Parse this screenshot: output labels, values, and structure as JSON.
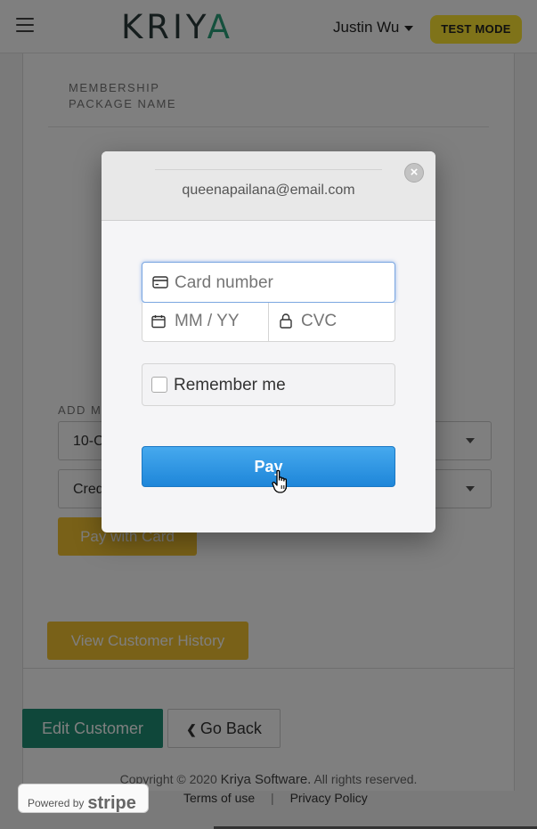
{
  "header": {
    "logo_text_1": "K",
    "logo_text_2": "RIY",
    "logo_text_3": "A",
    "user_name": "Justin Wu",
    "test_mode": "TEST MODE"
  },
  "form": {
    "membership_label_1": "MEMBERSHIP",
    "membership_label_2": "PACKAGE NAME",
    "add_label": "ADD M",
    "select_package_value": "10-C",
    "select_payment_value": "Cred",
    "pay_with_card": "Pay with Card",
    "view_history": "View Customer History"
  },
  "actions": {
    "edit_customer": "Edit Customer",
    "go_back": "Go Back"
  },
  "footer": {
    "copyright_prefix": "Copyright © 2020",
    "company": "Kriya Software.",
    "rights": "All rights reserved.",
    "terms": "Terms of use",
    "separator": "|",
    "privacy": "Privacy Policy",
    "powered_by": "Powered by",
    "stripe": "stripe"
  },
  "modal": {
    "email": "queenapailana@email.com",
    "card_number_placeholder": "Card number",
    "expiry_placeholder": "MM / YY",
    "cvc_placeholder": "CVC",
    "remember_me": "Remember me",
    "pay_label": "Pay"
  },
  "colors": {
    "accent_green": "#1f8f74",
    "accent_yellow": "#f2c230",
    "badge_yellow": "#ffe633",
    "pay_blue": "#2a92e0"
  }
}
